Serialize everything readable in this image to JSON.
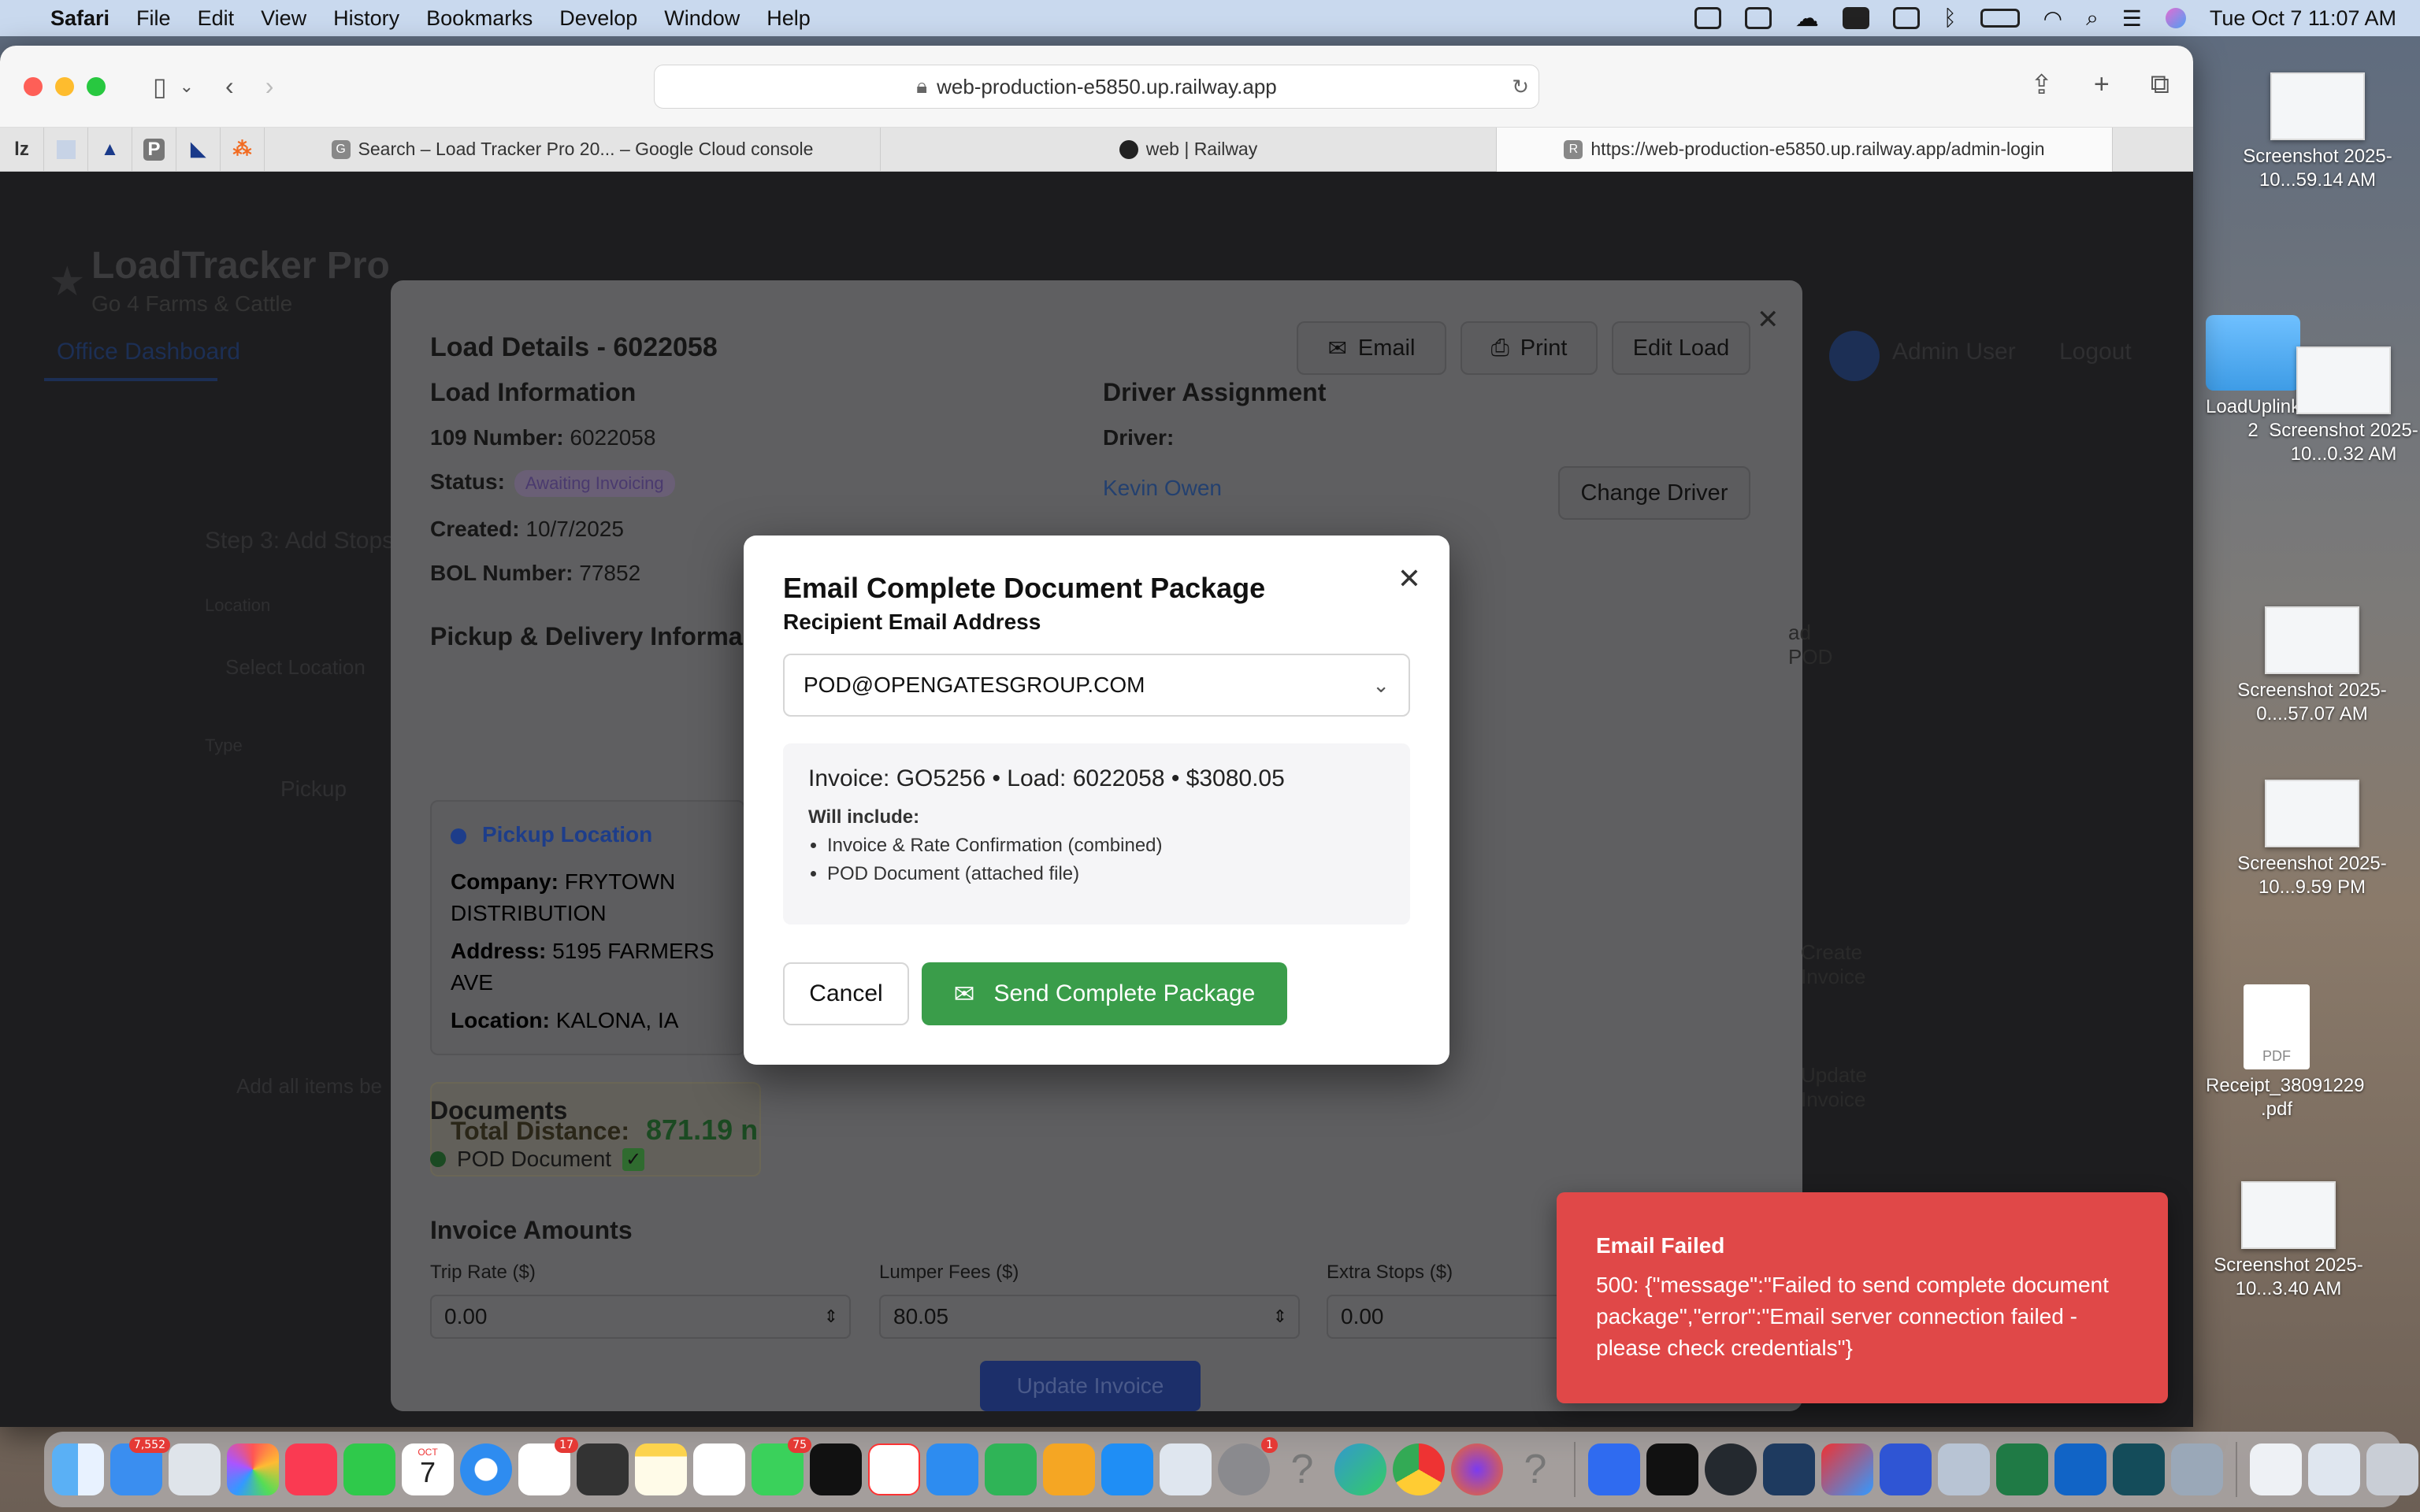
{
  "menubar": {
    "app": "Safari",
    "items": [
      "File",
      "Edit",
      "View",
      "History",
      "Bookmarks",
      "Develop",
      "Window",
      "Help"
    ],
    "datetime": "Tue Oct 7  11:07 AM"
  },
  "browser": {
    "url": "web-production-e5850.up.railway.app",
    "pinned_tabs": [
      "lz",
      "",
      "",
      "P",
      "",
      ""
    ],
    "tabs": [
      {
        "label": "Search – Load Tracker Pro 20... – Google Cloud console",
        "favicon": "G"
      },
      {
        "label": "web | Railway",
        "favicon": "R"
      },
      {
        "label": "https://web-production-e5850.up.railway.app/admin-login",
        "favicon": "R"
      }
    ]
  },
  "app": {
    "title": "LoadTracker Pro",
    "subtitle": "Go 4 Farms & Cattle",
    "nav_tab": "Office Dashboard",
    "user": "Admin User",
    "logout": "Logout",
    "bg_step": "Step 3: Add Stops",
    "bg_location": "Location",
    "bg_select_location": "Select Location",
    "bg_type": "Type",
    "bg_pickup": "Pickup",
    "bg_add_all": "Add all items be"
  },
  "load_details": {
    "title": "Load Details - 6022058",
    "btn_email": "Email",
    "btn_print": "Print",
    "btn_edit": "Edit Load",
    "load_info_heading": "Load Information",
    "number_label": "109 Number:",
    "number_value": "6022058",
    "status_label": "Status:",
    "status_value": "Awaiting Invoicing",
    "created_label": "Created:",
    "created_value": "10/7/2025",
    "bol_label": "BOL Number:",
    "bol_value": "77852",
    "driver_heading": "Driver Assignment",
    "driver_label": "Driver:",
    "driver_name": "Kevin Owen",
    "change_driver": "Change Driver",
    "pd_heading": "Pickup & Delivery Informa",
    "pickup_title": "Pickup Location",
    "company_label": "Company:",
    "company_value": "FRYTOWN DISTRIBUTION",
    "address_label": "Address:",
    "address_value": "5195 FARMERS AVE",
    "location_label": "Location:",
    "location_value": "KALONA, IA",
    "distance_label": "Total Distance:",
    "distance_value": "871.19 n",
    "documents_heading": "Documents",
    "pod_doc": "POD Document",
    "invoice_heading": "Invoice Amounts",
    "trip_rate_label": "Trip Rate ($)",
    "trip_rate_value": "0.00",
    "lumper_label": "Lumper Fees ($)",
    "lumper_value": "80.05",
    "extra_label": "Extra Stops ($)",
    "extra_value": "0.00",
    "update_invoice": "Update Invoice",
    "bg_pod": "ad POD",
    "bg_create_invoice": "Create Invoice",
    "bg_update_invoice": "Update Invoice"
  },
  "email_modal": {
    "title": "Email Complete Document Package",
    "recipient_label": "Recipient Email Address",
    "recipient_value": "POD@OPENGATESGROUP.COM",
    "summary": "Invoice: GO5256 • Load: 6022058 • $3080.05",
    "will_include": "Will include:",
    "includes": [
      "Invoice & Rate Confirmation (combined)",
      "POD Document (attached file)"
    ],
    "cancel": "Cancel",
    "send": "Send Complete Package"
  },
  "toast": {
    "title": "Email Failed",
    "message": "500: {\"message\":\"Failed to send complete document package\",\"error\":\"Email server connection failed - please check credentials\"}"
  },
  "desktop_icons": [
    {
      "label": "Screenshot 2025-10...59.14 AM"
    },
    {
      "label": "LoadUplink-2"
    },
    {
      "label": "Screenshot 2025-10...0.32 AM"
    },
    {
      "label": "Screenshot 2025-0....57.07 AM"
    },
    {
      "label": "Screenshot 2025-10...9.59 PM"
    },
    {
      "label": "Receipt_38091229 .pdf"
    },
    {
      "label": "Screenshot 2025-10...3.40 AM"
    }
  ],
  "dock": {
    "mail_badge": "7,552",
    "reminders_badge": "17",
    "messages_badge": "75",
    "settings_badge": "1",
    "calendar_month": "OCT",
    "calendar_day": "7"
  },
  "colors": {
    "send_green": "#3a9d4a",
    "toast_red": "#e04848",
    "driver_link": "#2f5ea8"
  }
}
